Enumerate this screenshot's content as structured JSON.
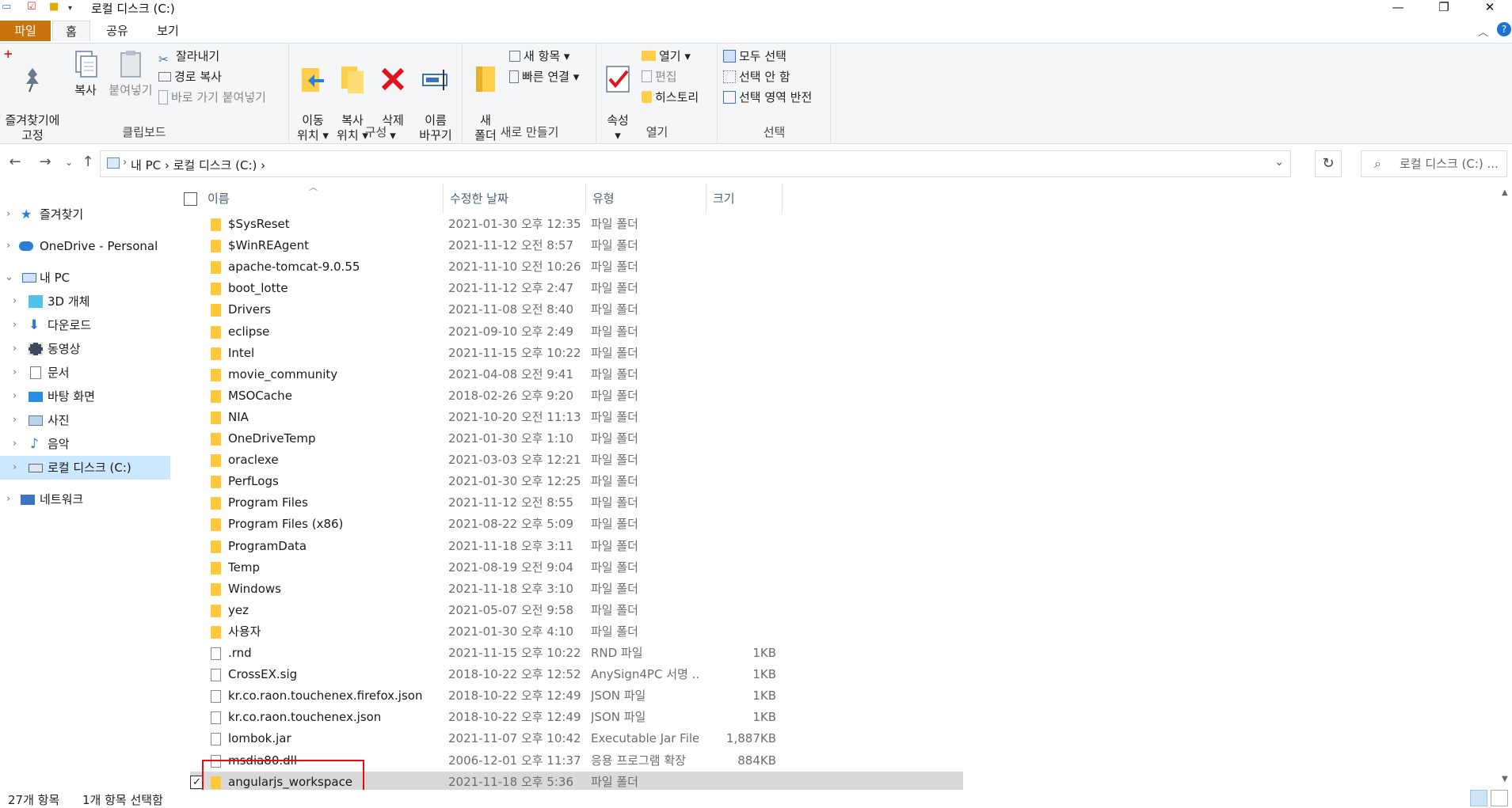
{
  "window": {
    "title": "로컬 디스크 (C:)",
    "minimize": "—",
    "restore": "❐",
    "close": "✕"
  },
  "ribbon_tabs": [
    "파일",
    "홈",
    "공유",
    "보기"
  ],
  "ribbon": {
    "clipboard": {
      "pin": "즐겨찾기에\n고정",
      "copy": "복사",
      "paste": "붙여넣기",
      "cut": "잘라내기",
      "copy_path": "경로 복사",
      "paste_shortcut": "바로 가기 붙여넣기",
      "label": "클립보드"
    },
    "organize": {
      "move_to": "이동\n위치 ▾",
      "copy_to": "복사\n위치 ▾",
      "delete": "삭제\n▾",
      "rename": "이름\n바꾸기",
      "label": "구성"
    },
    "new": {
      "new_folder": "새\n폴더",
      "new_item": "새 항목 ▾",
      "easy_access": "빠른 연결 ▾",
      "label": "새로 만들기"
    },
    "open": {
      "properties": "속성\n▾",
      "open": "열기 ▾",
      "edit": "편집",
      "history": "히스토리",
      "label": "열기"
    },
    "select": {
      "select_all": "모두 선택",
      "select_none": "선택 안 함",
      "invert": "선택 영역 반전",
      "label": "선택"
    }
  },
  "address": {
    "crumbs": "내 PC  ›  로컬 디스크 (C:)  ›",
    "search_placeholder": "로컬 디스크 (C:) ..."
  },
  "nav": {
    "items": [
      {
        "label": "즐겨찾기"
      },
      {
        "label": "OneDrive - Personal"
      },
      {
        "label": "내 PC"
      },
      {
        "label": "3D 개체"
      },
      {
        "label": "다운로드"
      },
      {
        "label": "동영상"
      },
      {
        "label": "문서"
      },
      {
        "label": "바탕 화면"
      },
      {
        "label": "사진"
      },
      {
        "label": "음악"
      },
      {
        "label": "로컬 디스크 (C:)"
      },
      {
        "label": "네트워크"
      }
    ]
  },
  "columns": {
    "name": "이름",
    "date": "수정한 날짜",
    "type": "유형",
    "size": "크기"
  },
  "files": [
    {
      "name": "$SysReset",
      "date": "2021-01-30 오후 12:35",
      "type": "파일 폴더",
      "size": "",
      "kind": "folder"
    },
    {
      "name": "$WinREAgent",
      "date": "2021-11-12 오전 8:57",
      "type": "파일 폴더",
      "size": "",
      "kind": "folder"
    },
    {
      "name": "apache-tomcat-9.0.55",
      "date": "2021-11-10 오전 10:26",
      "type": "파일 폴더",
      "size": "",
      "kind": "folder"
    },
    {
      "name": "boot_lotte",
      "date": "2021-11-12 오후 2:47",
      "type": "파일 폴더",
      "size": "",
      "kind": "folder"
    },
    {
      "name": "Drivers",
      "date": "2021-11-08 오전 8:40",
      "type": "파일 폴더",
      "size": "",
      "kind": "folder"
    },
    {
      "name": "eclipse",
      "date": "2021-09-10 오후 2:49",
      "type": "파일 폴더",
      "size": "",
      "kind": "folder"
    },
    {
      "name": "Intel",
      "date": "2021-11-15 오후 10:22",
      "type": "파일 폴더",
      "size": "",
      "kind": "folder"
    },
    {
      "name": "movie_community",
      "date": "2021-04-08 오전 9:41",
      "type": "파일 폴더",
      "size": "",
      "kind": "folder"
    },
    {
      "name": "MSOCache",
      "date": "2018-02-26 오후 9:20",
      "type": "파일 폴더",
      "size": "",
      "kind": "folder"
    },
    {
      "name": "NIA",
      "date": "2021-10-20 오전 11:13",
      "type": "파일 폴더",
      "size": "",
      "kind": "folder"
    },
    {
      "name": "OneDriveTemp",
      "date": "2021-01-30 오후 1:10",
      "type": "파일 폴더",
      "size": "",
      "kind": "folder"
    },
    {
      "name": "oraclexe",
      "date": "2021-03-03 오후 12:21",
      "type": "파일 폴더",
      "size": "",
      "kind": "folder"
    },
    {
      "name": "PerfLogs",
      "date": "2021-01-30 오후 12:25",
      "type": "파일 폴더",
      "size": "",
      "kind": "folder"
    },
    {
      "name": "Program Files",
      "date": "2021-11-12 오전 8:55",
      "type": "파일 폴더",
      "size": "",
      "kind": "folder"
    },
    {
      "name": "Program Files (x86)",
      "date": "2021-08-22 오후 5:09",
      "type": "파일 폴더",
      "size": "",
      "kind": "folder"
    },
    {
      "name": "ProgramData",
      "date": "2021-11-18 오후 3:11",
      "type": "파일 폴더",
      "size": "",
      "kind": "folder"
    },
    {
      "name": "Temp",
      "date": "2021-08-19 오전 9:04",
      "type": "파일 폴더",
      "size": "",
      "kind": "folder"
    },
    {
      "name": "Windows",
      "date": "2021-11-18 오후 3:10",
      "type": "파일 폴더",
      "size": "",
      "kind": "folder"
    },
    {
      "name": "yez",
      "date": "2021-05-07 오전 9:58",
      "type": "파일 폴더",
      "size": "",
      "kind": "folder"
    },
    {
      "name": "사용자",
      "date": "2021-01-30 오후 4:10",
      "type": "파일 폴더",
      "size": "",
      "kind": "folder"
    },
    {
      "name": ".rnd",
      "date": "2021-11-15 오후 10:22",
      "type": "RND 파일",
      "size": "1KB",
      "kind": "file"
    },
    {
      "name": "CrossEX.sig",
      "date": "2018-10-22 오후 12:52",
      "type": "AnySign4PC 서명 ...",
      "size": "1KB",
      "kind": "file"
    },
    {
      "name": "kr.co.raon.touchenex.firefox.json",
      "date": "2018-10-22 오후 12:49",
      "type": "JSON 파일",
      "size": "1KB",
      "kind": "file"
    },
    {
      "name": "kr.co.raon.touchenex.json",
      "date": "2018-10-22 오후 12:49",
      "type": "JSON 파일",
      "size": "1KB",
      "kind": "file"
    },
    {
      "name": "lombok.jar",
      "date": "2021-11-07 오후 10:42",
      "type": "Executable Jar File",
      "size": "1,887KB",
      "kind": "file"
    },
    {
      "name": "msdia80.dll",
      "date": "2006-12-01 오후 11:37",
      "type": "응용 프로그램 확장",
      "size": "884KB",
      "kind": "file"
    },
    {
      "name": "angularjs_workspace",
      "date": "2021-11-18 오후 5:36",
      "type": "파일 폴더",
      "size": "",
      "kind": "folder",
      "selected": true
    }
  ],
  "status": {
    "count": "27개 항목",
    "selected": "1개 항목 선택함"
  },
  "colors": {
    "file_tab": "#c8730e",
    "folder": "#ffc73a",
    "nav_selected": "#cce8ff",
    "row_selected": "#d9d9d9",
    "highlight_box": "#e01010"
  }
}
